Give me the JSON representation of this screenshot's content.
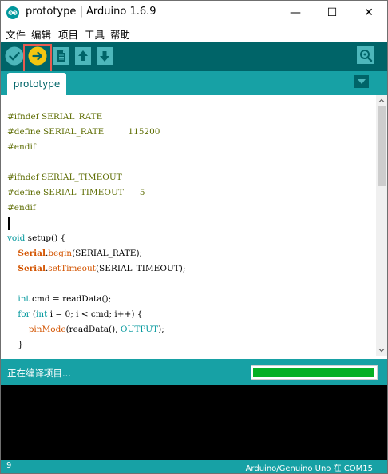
{
  "window": {
    "title": "prototype | Arduino 1.6.9",
    "min_glyph": "—",
    "max_glyph": "☐",
    "close_glyph": "✕"
  },
  "menu": [
    "文件",
    "编辑",
    "项目",
    "工具",
    "帮助"
  ],
  "toolbar": {
    "buttons": [
      "verify-icon",
      "upload-icon",
      "new-icon",
      "open-icon",
      "save-icon"
    ],
    "right_button": "serial-monitor-icon",
    "highlighted": "upload-button"
  },
  "tabs": {
    "active": "prototype",
    "menu_icon": "triangle-down-icon"
  },
  "code": {
    "lines": [
      "",
      "#ifndef SERIAL_RATE",
      "#define SERIAL_RATE         115200",
      "#endif",
      "",
      "#ifndef SERIAL_TIMEOUT",
      "#define SERIAL_TIMEOUT      5",
      "#endif",
      "",
      "void setup() {",
      "    Serial.begin(SERIAL_RATE);",
      "    Serial.setTimeout(SERIAL_TIMEOUT);",
      "",
      "    int cmd = readData();",
      "    for (int i = 0; i < cmd; i++) {",
      "        pinMode(readData(), OUTPUT);",
      "    }"
    ]
  },
  "status": {
    "message": "正在编译项目...",
    "progress": 0.99
  },
  "footer": {
    "line_number": "9",
    "board_info": "Arduino/Genuino Uno 在 COM15"
  },
  "colors": {
    "toolbar": "#006468",
    "tabs": "#17a1a5",
    "accent_button": "#f3c511",
    "progress": "#06b025",
    "highlight": "#e85a4f"
  }
}
